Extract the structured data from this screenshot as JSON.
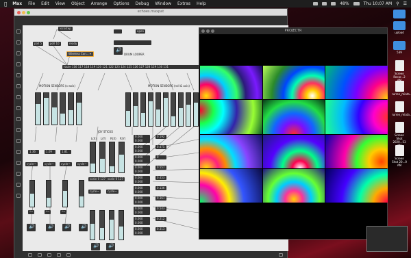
{
  "menubar": {
    "apple": "",
    "app": "Max",
    "items": [
      "File",
      "Edit",
      "View",
      "Object",
      "Arrange",
      "Options",
      "Debug",
      "Window",
      "Extras",
      "Help"
    ],
    "battery": "48%",
    "clock": "Thu 10:07 AM"
  },
  "max_window": {
    "title": "echoes.maxpat",
    "objects": {
      "lockstep": "lockstep",
      "poll5": "poll 5",
      "poll10": "poll 10",
      "ready": "ready",
      "menu": "Wireless Con...",
      "open": "open",
      "drum_label": "DRUM LOOPER",
      "route": "route 116 117 118 119 120 121 122 123 124 125 126 127 128 129 130 131",
      "motion_left": "MOTION SENSORS (x-axis)",
      "motion_right": "MOTION SENSORS (roll & axis)",
      "joy_label": "JOY STICKS",
      "joy_cols": [
        "L(X)",
        "L(Y)",
        "R(X)",
        "R(Y)"
      ],
      "scale_vals": [
        "1.36",
        "1.09",
        "1.81"
      ],
      "cycle": "cycle~",
      "mult": "*~",
      "scale": "scale 0 127",
      "line_vals": [
        "0.000 0.000",
        "0.000 0.000",
        "0.000 0.000",
        "0.000 0.000",
        "0.000 0.000",
        "0.000 0.000",
        "0.000 0.000",
        "0.000 0.000",
        "0.000 0.000",
        "0.000 0.000"
      ],
      "out_vals": [
        "0.192",
        "0.475",
        "0",
        "0.557",
        "0.453",
        "0.136",
        "0.361",
        "0.543",
        "0.212",
        "0.313"
      ]
    }
  },
  "projector_window": {
    "title": "PROJECTR"
  },
  "desktop_icons": [
    {
      "label": "",
      "kind": "folder"
    },
    {
      "label": "upload",
      "kind": "folder"
    },
    {
      "label": "539",
      "kind": "folder"
    },
    {
      "label": "Screen Recor...2 AM",
      "kind": "doc"
    },
    {
      "label": "rurren_miata...mmigration",
      "kind": "doc"
    },
    {
      "label": "rurren_miata...pool",
      "kind": "doc"
    },
    {
      "label": "Screen Shot 2020...53 AM",
      "kind": "doc"
    },
    {
      "label": "Screen Shot 20...0 AM",
      "kind": "doc"
    }
  ],
  "colors": {
    "max_bg": "#eaeaea",
    "object_bg": "#333333",
    "slider_fill": "#c7e3e3",
    "accent": "#f0a830"
  },
  "slider_levels": {
    "motion_left": [
      0.65,
      0.85,
      0.55,
      0.35,
      0.45,
      0.7
    ],
    "motion_right": [
      0.45,
      0.6,
      0.4,
      0.75,
      0.5,
      0.85,
      0.3,
      0.55,
      0.65,
      0.7,
      0.8,
      0.4
    ],
    "joy": [
      0.3,
      0.45,
      0.2,
      0.6
    ],
    "lower_left": [
      0.5,
      0.35,
      0.6,
      0.4
    ],
    "lower_mid": [
      0.55,
      0.4,
      0.7,
      0.45
    ]
  }
}
